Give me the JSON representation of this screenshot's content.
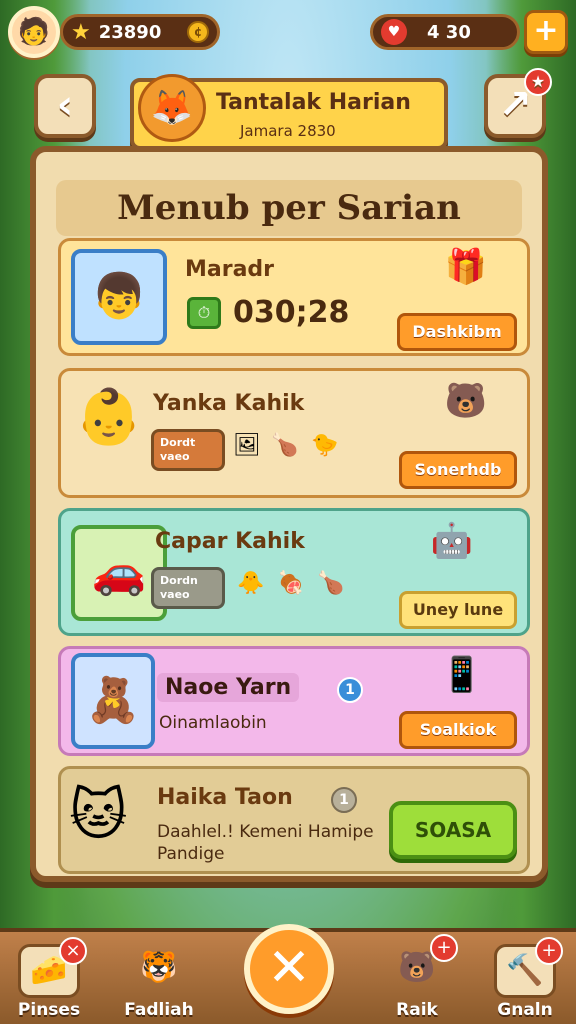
{
  "hud": {
    "avatar_icon": "🧑",
    "star_icon": "★",
    "coins_value": "23890",
    "coin_icon": "¢",
    "heart_icon": "♥",
    "gems_value": "4 30",
    "plus_label": "+"
  },
  "header": {
    "back_icon": "‹",
    "share_icon": "↗",
    "share_badge": "★",
    "mascot_icon": "🦊",
    "title": "Tantalak Harian",
    "subtitle": "Jamara 2830"
  },
  "board": {
    "title": "Menub per Sarian",
    "cards": [
      {
        "thumb_icon": "👦",
        "name": "Maradr",
        "timer_icon": "⏱",
        "timer_value": "030;28",
        "deco_icon": "🎁",
        "button_label": "Dashkibm"
      },
      {
        "thumb_icon": "👶",
        "name": "Yanka Kahik",
        "tag_text": "Dordt\nvaeo",
        "mini_icons": [
          "🖼",
          "🍗",
          "🐤"
        ],
        "deco_icon": "🐻",
        "button_label": "Sonerhdb"
      },
      {
        "thumb_icon": "🚗",
        "name": "Capar Kahik",
        "tag_text": "Dordn\nvaeo",
        "mini_icons": [
          "🐥",
          "🍖",
          "🍗"
        ],
        "deco_icon": "🤖",
        "button_label": "Uney lune"
      },
      {
        "thumb_icon": "🧸",
        "name": "Naoe Yarn",
        "info_label": "1",
        "sub": "Oinamlaobin",
        "deco_icon": "📱",
        "button_label": "Soalkiok"
      },
      {
        "thumb_icon": "🐱",
        "name": "Haika Taon",
        "info_label": "1",
        "sub": "Daahlel.! Kemeni Hamipe\nPandige",
        "button_label": "SOASA"
      }
    ]
  },
  "nav": {
    "items": [
      {
        "icon": "🧀",
        "label": "Pinses",
        "badge": "×"
      },
      {
        "icon": "🐯",
        "label": "Fadliah"
      },
      {
        "icon": "🐻",
        "label": "Raik",
        "badge": "+"
      },
      {
        "icon": "🔨",
        "label": "Gnaln",
        "badge": "+"
      }
    ],
    "center_icon": "✕"
  }
}
